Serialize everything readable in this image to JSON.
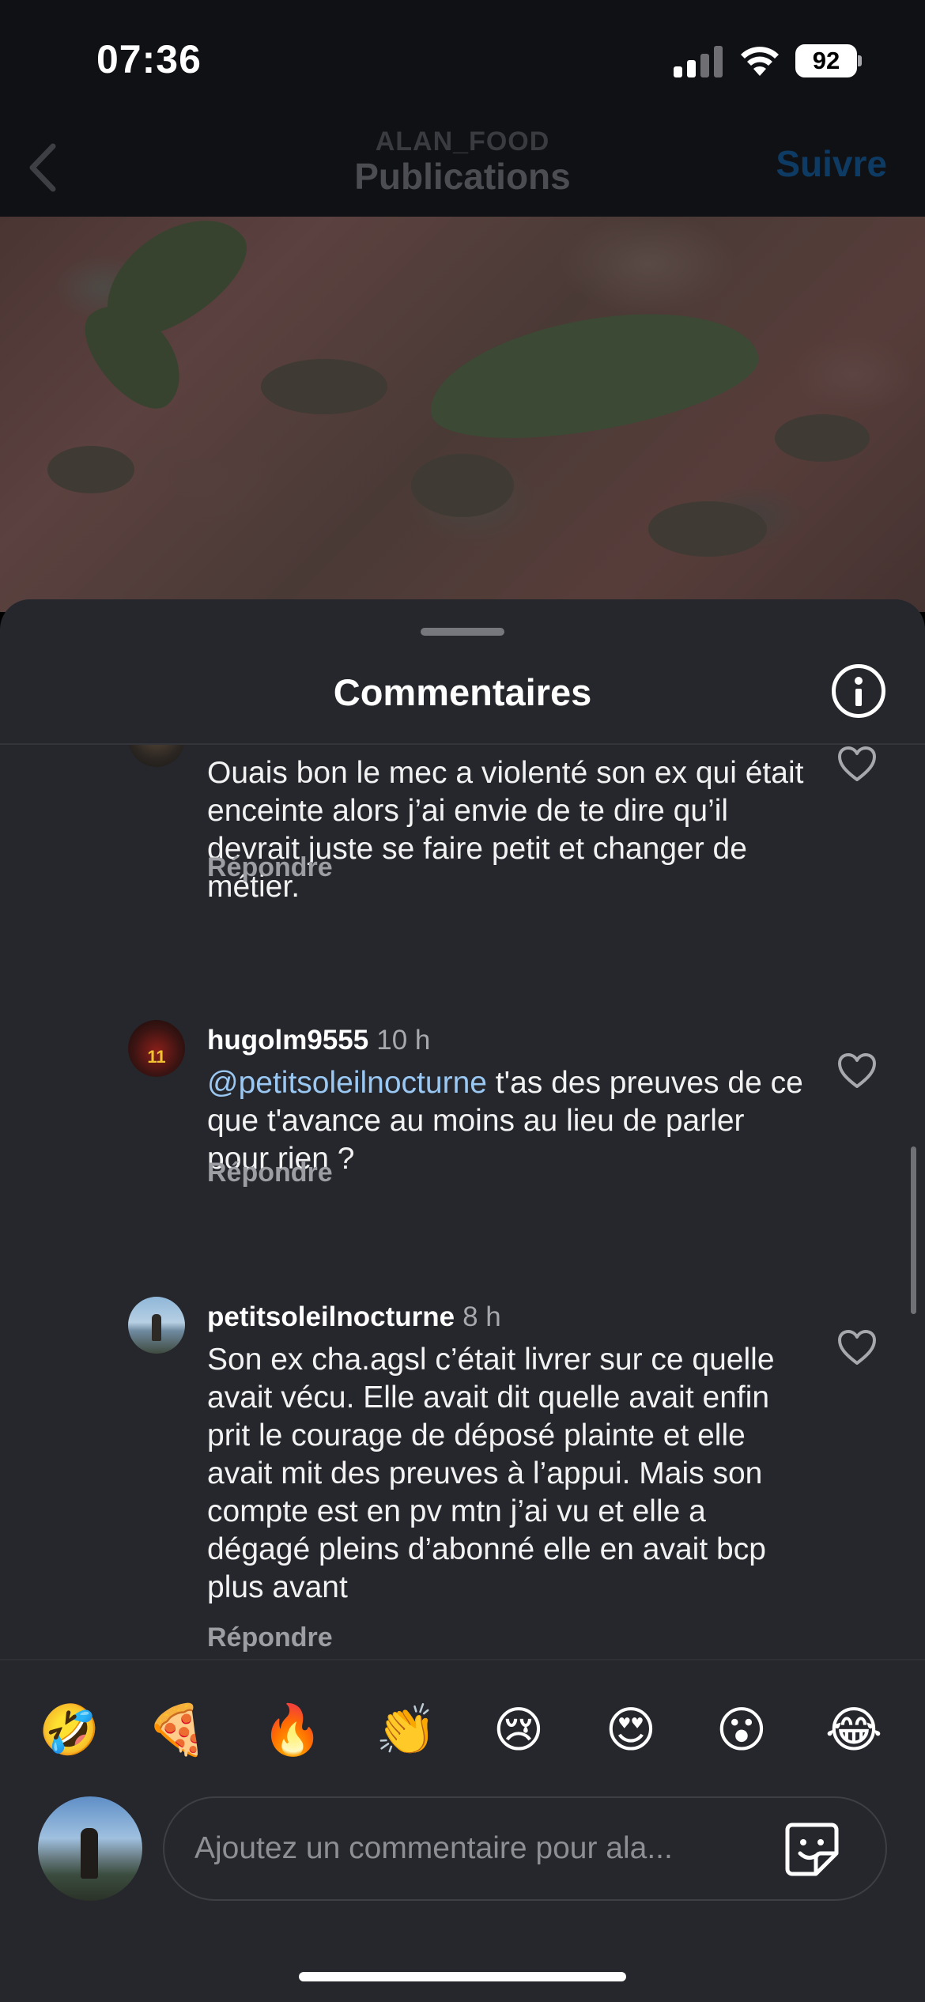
{
  "status_bar": {
    "time": "07:36",
    "battery": "92"
  },
  "header": {
    "username": "ALAN_FOOD",
    "title": "Publications",
    "follow_label": "Suivre"
  },
  "comments_sheet": {
    "title": "Commentaires",
    "comments": [
      {
        "username": "",
        "time": "",
        "text": "Ouais bon le mec a violenté son ex qui était enceinte alors j’ai envie de te dire qu’il devrait juste se faire petit et changer de métier.",
        "reply_label": "Répondre"
      },
      {
        "username": "hugolm9555",
        "time": "10 h",
        "mention": "@petitsoleilnocturne",
        "text": " t'as des preuves de ce que t'avance au moins au lieu de parler pour rien ?",
        "reply_label": "Répondre"
      },
      {
        "username": "petitsoleilnocturne",
        "time": "8 h",
        "text": "Son ex cha.agsl c’était livrer sur ce quelle avait vécu. Elle avait dit quelle avait enfin prit le courage de déposé plainte et elle avait mit des preuves à l’appui. Mais son compte est en pv mtn j’ai vu et elle a dégagé pleins d’abonné elle en avait bcp plus avant",
        "reply_label": "Répondre"
      }
    ]
  },
  "emoji_bar": [
    "🤣",
    "🍕",
    "🔥",
    "👏",
    "😢",
    "😍",
    "😮",
    "😂"
  ],
  "input": {
    "placeholder": "Ajoutez un commentaire pour ala..."
  }
}
